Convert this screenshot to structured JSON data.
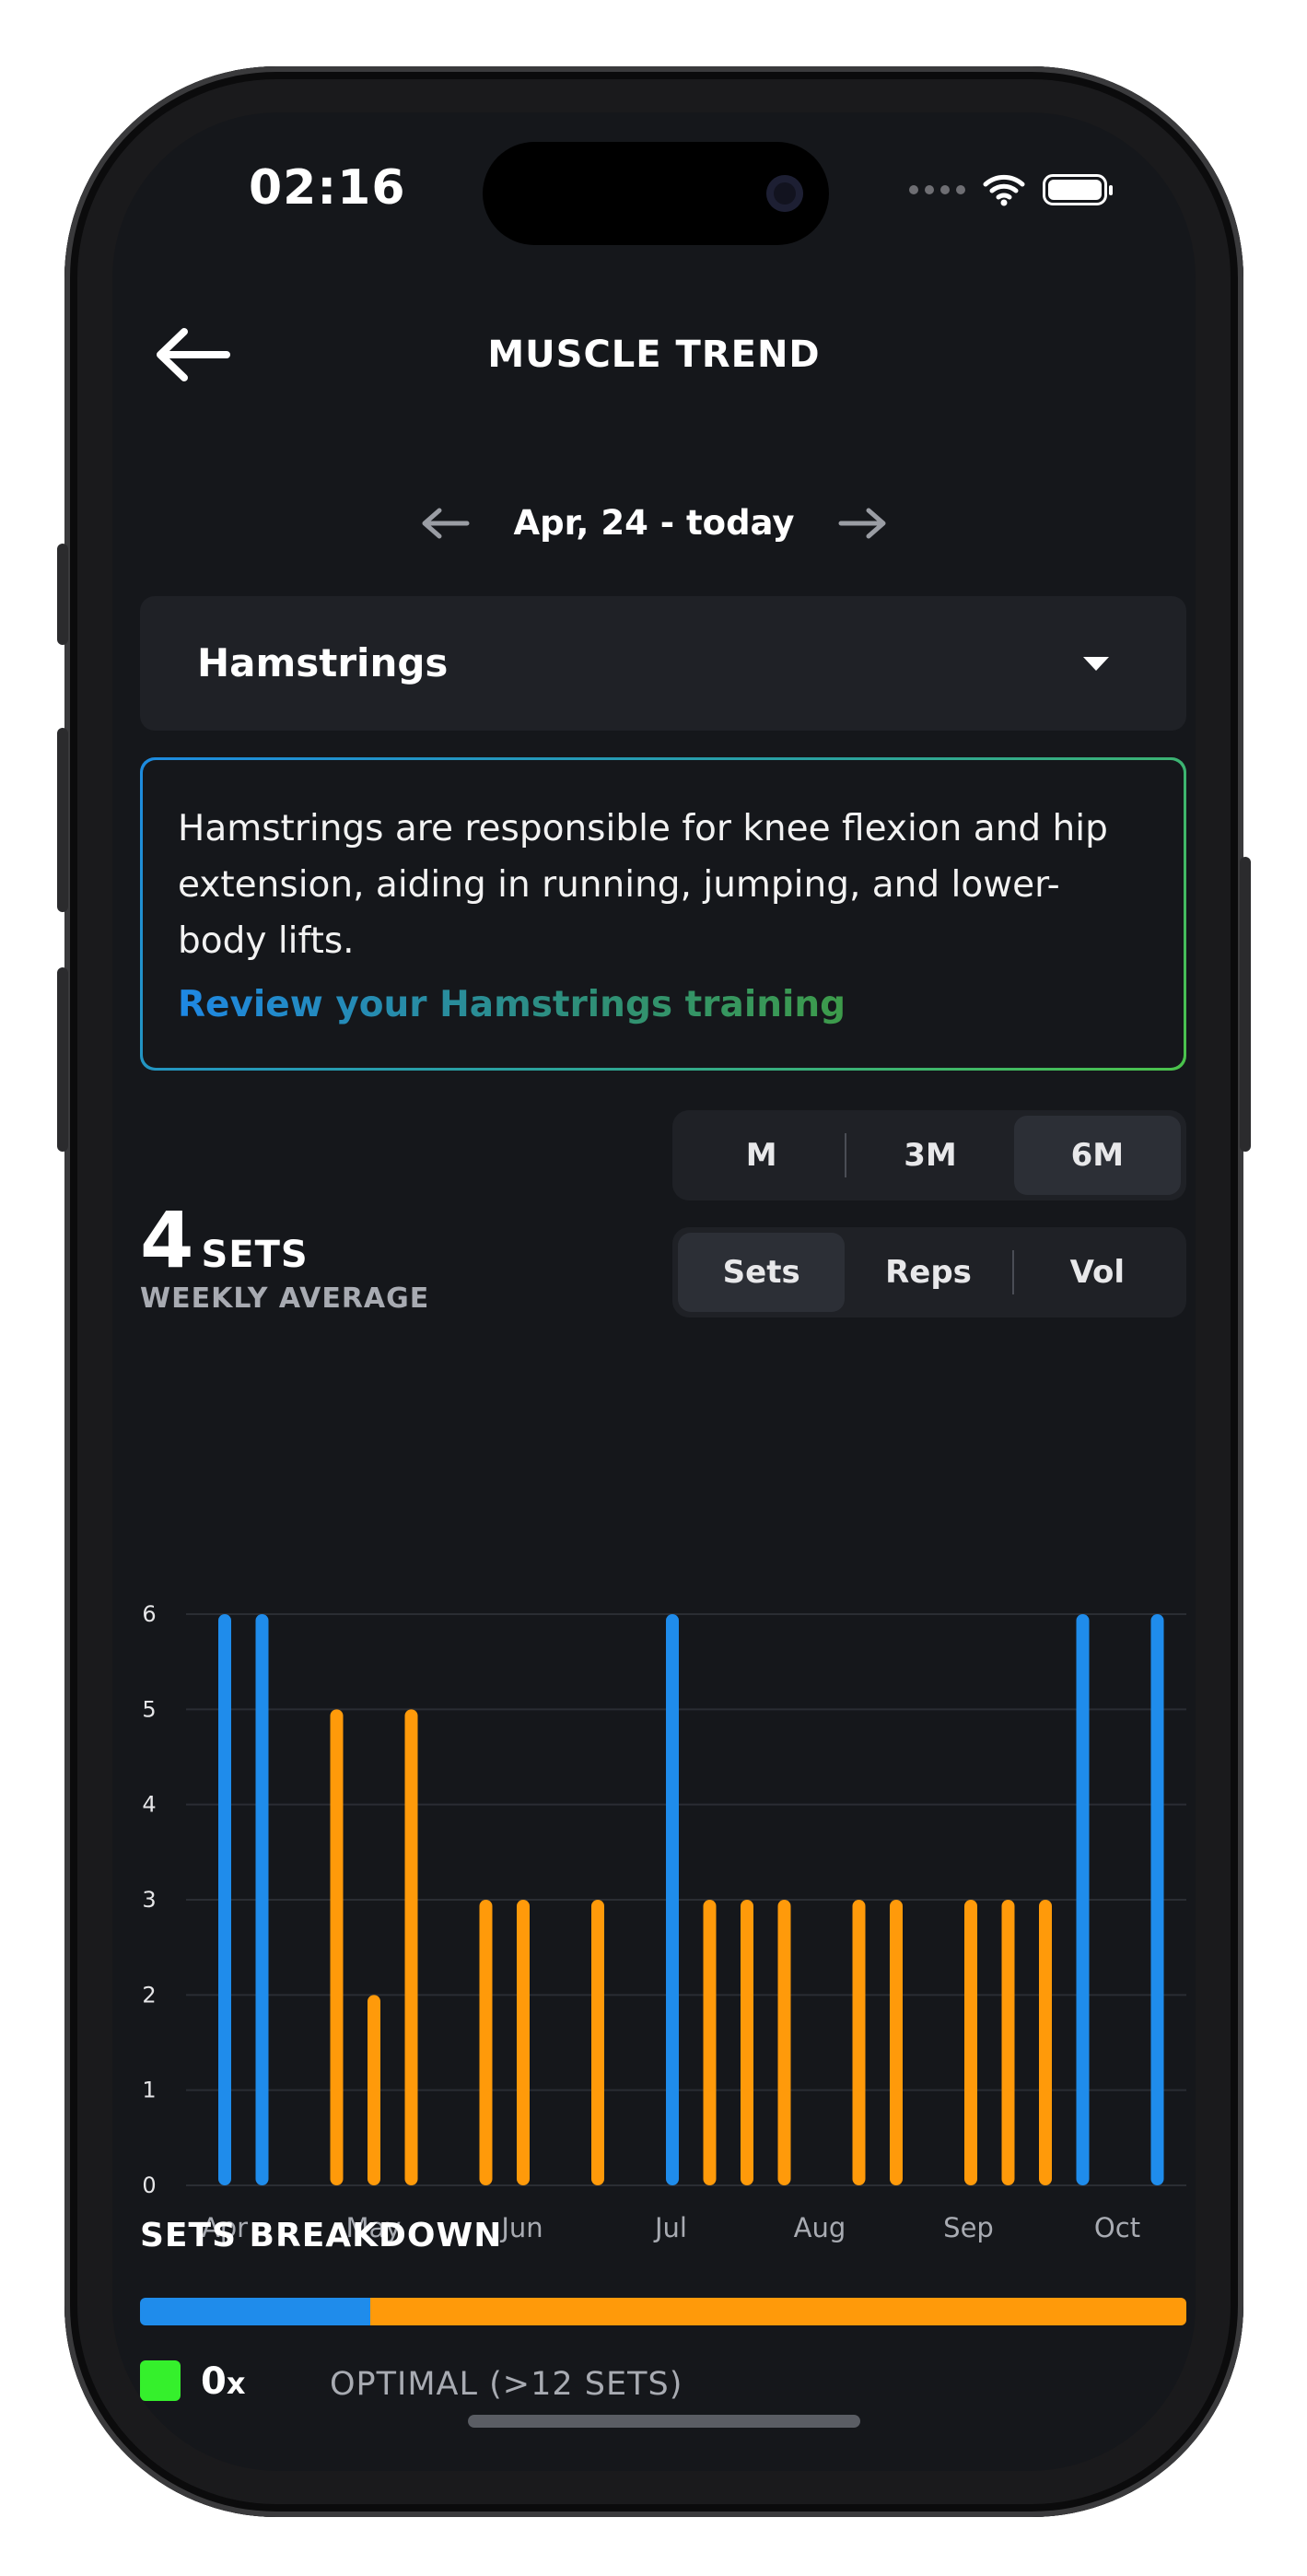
{
  "status_bar": {
    "time": "02:16"
  },
  "header": {
    "title": "MUSCLE TREND"
  },
  "date_range": {
    "label": "Apr, 24 - today"
  },
  "muscle_select": {
    "selected": "Hamstrings"
  },
  "info_card": {
    "description": "Hamstrings are responsible for knee flexion and hip extension, aiding in running, jumping, and lower-body lifts.",
    "link": "Review your Hamstrings training"
  },
  "range_tabs": {
    "options": [
      "M",
      "3M",
      "6M"
    ],
    "selected": "6M"
  },
  "metric_tabs": {
    "options": [
      "Sets",
      "Reps",
      "Vol"
    ],
    "selected": "Sets"
  },
  "summary": {
    "value": "4",
    "unit": "SETS",
    "caption": "WEEKLY AVERAGE"
  },
  "colors": {
    "blue": "#1f8ceb",
    "orange": "#ff9a0a",
    "green": "#35f02c",
    "background": "#15171b"
  },
  "chart_data": {
    "type": "bar",
    "ylim": [
      0,
      6
    ],
    "yticks": [
      "0",
      "1",
      "2",
      "3",
      "4",
      "5",
      "6"
    ],
    "xticks": [
      "Apr",
      "May",
      "Jun",
      "Jul",
      "Aug",
      "Sep",
      "Oct"
    ],
    "bars": [
      {
        "week": 0,
        "value": 6,
        "color": "blue"
      },
      {
        "week": 1,
        "value": 6,
        "color": "blue"
      },
      {
        "week": 3,
        "value": 5,
        "color": "orange"
      },
      {
        "week": 4,
        "value": 2,
        "color": "orange"
      },
      {
        "week": 5,
        "value": 5,
        "color": "orange"
      },
      {
        "week": 7,
        "value": 3,
        "color": "orange"
      },
      {
        "week": 8,
        "value": 3,
        "color": "orange"
      },
      {
        "week": 10,
        "value": 3,
        "color": "orange"
      },
      {
        "week": 12,
        "value": 6,
        "color": "blue"
      },
      {
        "week": 13,
        "value": 3,
        "color": "orange"
      },
      {
        "week": 14,
        "value": 3,
        "color": "orange"
      },
      {
        "week": 15,
        "value": 3,
        "color": "orange"
      },
      {
        "week": 17,
        "value": 3,
        "color": "orange"
      },
      {
        "week": 18,
        "value": 3,
        "color": "orange"
      },
      {
        "week": 20,
        "value": 3,
        "color": "orange"
      },
      {
        "week": 21,
        "value": 3,
        "color": "orange"
      },
      {
        "week": 22,
        "value": 3,
        "color": "orange"
      },
      {
        "week": 23,
        "value": 6,
        "color": "blue"
      },
      {
        "week": 25,
        "value": 6,
        "color": "blue"
      }
    ]
  },
  "breakdown": {
    "title": "SETS BREAKDOWN",
    "segments": [
      {
        "color": "blue",
        "fraction": 0.22
      },
      {
        "color": "orange",
        "fraction": 0.78
      }
    ],
    "legend": {
      "count": "0",
      "suffix": "x",
      "label": "OPTIMAL (>12 SETS)"
    }
  }
}
